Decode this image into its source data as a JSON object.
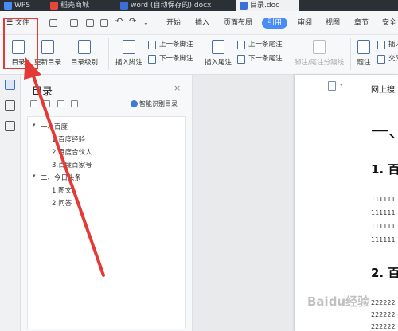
{
  "tabs": [
    {
      "label": "WPS",
      "active": false
    },
    {
      "label": "稻壳商城",
      "active": false
    },
    {
      "label": "word (自动保存的).docx",
      "active": false
    },
    {
      "label": "目录.doc",
      "active": true
    }
  ],
  "menubar": {
    "file_label": "文件",
    "items": [
      "开始",
      "插入",
      "页面布局",
      "引用",
      "审阅",
      "视图",
      "章节",
      "安全"
    ],
    "active_item": "引用"
  },
  "ribbon": {
    "toc": "目录",
    "update_toc": "更新目录",
    "toc_level": "目录级别",
    "insert_footnote": "插入脚注",
    "prev_footnote": "上一条脚注",
    "next_footnote": "下一条脚注",
    "insert_endnote": "插入尾注",
    "prev_endnote": "上一条尾注",
    "next_endnote": "下一条尾注",
    "separator": "脚注/尾注分隔线",
    "caption": "题注",
    "insert_caption": "插入",
    "cross_ref": "交叉"
  },
  "pane": {
    "title": "目录",
    "close": "×",
    "smart_btn": "智能识别目录",
    "items": [
      {
        "label": "一、百度",
        "level": 1
      },
      {
        "label": "1.百度经验",
        "level": 2
      },
      {
        "label": "2.百度合伙人",
        "level": 2
      },
      {
        "label": "3.百度百家号",
        "level": 2
      },
      {
        "label": "二、今日头条",
        "level": 1
      },
      {
        "label": "1.图文",
        "level": 2
      },
      {
        "label": "2.问答",
        "level": 2
      }
    ]
  },
  "document": {
    "top_line": "网上搜",
    "h1": "一、",
    "h2a": "1. 百",
    "lines_a": [
      "111111",
      "111111",
      "111111",
      "111111"
    ],
    "h2b": "2. 百",
    "lines_b": [
      "222222",
      "222222",
      "222222"
    ]
  },
  "watermark": "Baidu经验",
  "colors": {
    "accent": "#4a8cf7",
    "annotation": "#e53935"
  }
}
